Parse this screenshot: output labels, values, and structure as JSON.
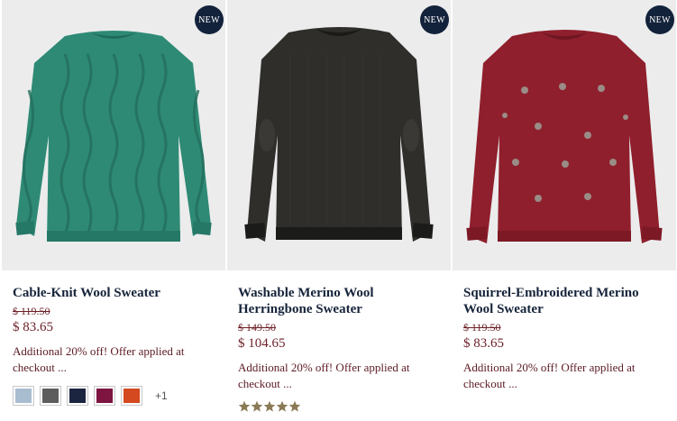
{
  "products": [
    {
      "badge": "NEW",
      "name": "Cable-Knit Wool Sweater",
      "original_price": "$ 119.50",
      "sale_price": "$ 83.65",
      "promo": "Additional 20% off! Offer applied at checkout ...",
      "sweater_color": "#2e8a74",
      "swatches": [
        "#a9bdd1",
        "#5d5d5d",
        "#1c2540",
        "#7d1540",
        "#d4491f"
      ],
      "more_swatches": "+1"
    },
    {
      "badge": "NEW",
      "name": "Washable Merino Wool Herringbone Sweater",
      "original_price": "$ 149.50",
      "sale_price": "$ 104.65",
      "promo": "Additional 20% off! Offer applied at checkout ...",
      "sweater_color": "#2f2e2b",
      "rating": 5,
      "rating_color": "#8a7a55"
    },
    {
      "badge": "NEW",
      "name": "Squirrel-Embroidered Merino Wool Sweater",
      "original_price": "$ 119.50",
      "sale_price": "$ 83.65",
      "promo": "Additional 20% off! Offer applied at checkout ...",
      "sweater_color": "#8f1f2c"
    }
  ]
}
